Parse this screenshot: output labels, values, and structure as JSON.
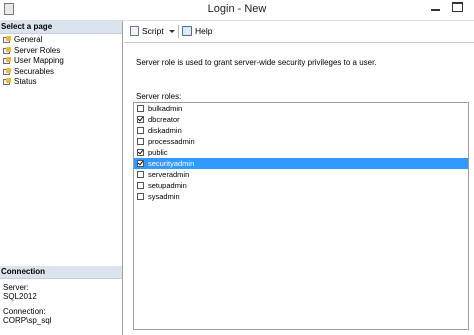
{
  "window": {
    "title": "Login - New"
  },
  "left_pane": {
    "select_page_header": "Select a page",
    "pages": [
      {
        "label": "General",
        "icon": "page-icon"
      },
      {
        "label": "Server Roles",
        "icon": "page-icon"
      },
      {
        "label": "User Mapping",
        "icon": "page-icon"
      },
      {
        "label": "Securables",
        "icon": "page-icon"
      },
      {
        "label": "Status",
        "icon": "page-icon"
      }
    ],
    "connection": {
      "header": "Connection",
      "server_label": "Server:",
      "server_value": "SQL2012",
      "connection_label": "Connection:",
      "connection_value": "CORP\\sp_sql"
    }
  },
  "toolbar": {
    "script_label": "Script",
    "help_label": "Help"
  },
  "main": {
    "description": "Server role is used to grant server-wide security privileges to a user.",
    "roles_label": "Server roles:",
    "roles": [
      {
        "name": "bulkadmin",
        "checked": false,
        "selected": false
      },
      {
        "name": "dbcreator",
        "checked": true,
        "selected": false
      },
      {
        "name": "diskadmin",
        "checked": false,
        "selected": false
      },
      {
        "name": "processadmin",
        "checked": false,
        "selected": false
      },
      {
        "name": "public",
        "checked": true,
        "selected": false
      },
      {
        "name": "securityadmin",
        "checked": true,
        "selected": true
      },
      {
        "name": "serveradmin",
        "checked": false,
        "selected": false
      },
      {
        "name": "setupadmin",
        "checked": false,
        "selected": false
      },
      {
        "name": "sysadmin",
        "checked": false,
        "selected": false
      }
    ]
  },
  "colors": {
    "selection": "#3399ff",
    "section_header": "#dbe3ee"
  }
}
